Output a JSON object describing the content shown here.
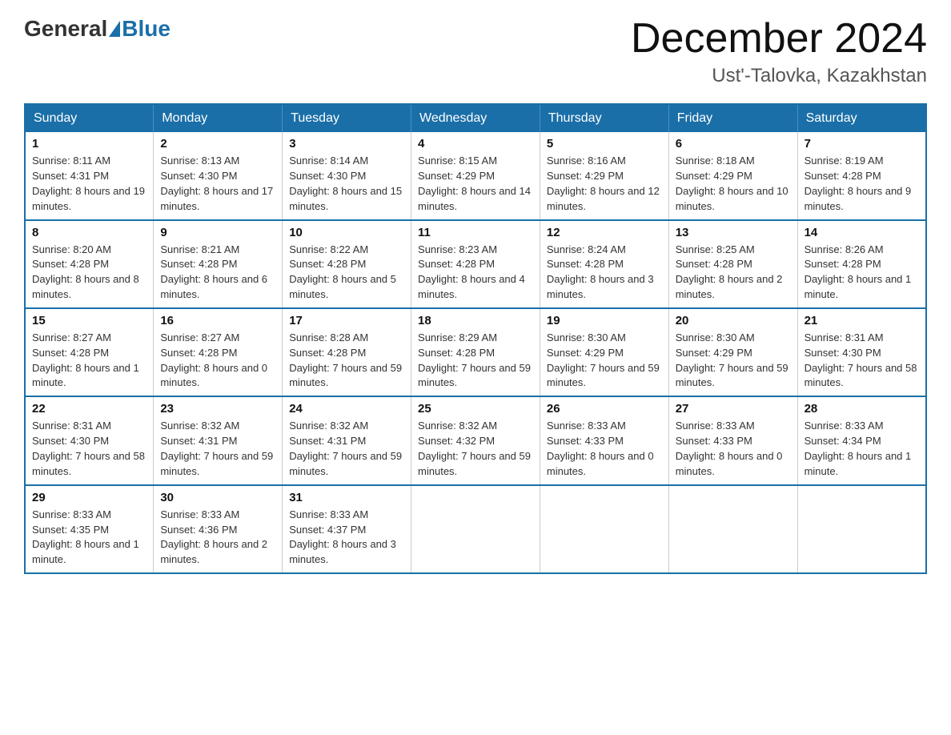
{
  "header": {
    "logo_general": "General",
    "logo_blue": "Blue",
    "title": "December 2024",
    "subtitle": "Ust'-Talovka, Kazakhstan"
  },
  "weekdays": [
    "Sunday",
    "Monday",
    "Tuesday",
    "Wednesday",
    "Thursday",
    "Friday",
    "Saturday"
  ],
  "weeks": [
    [
      {
        "day": "1",
        "sunrise": "8:11 AM",
        "sunset": "4:31 PM",
        "daylight": "8 hours and 19 minutes."
      },
      {
        "day": "2",
        "sunrise": "8:13 AM",
        "sunset": "4:30 PM",
        "daylight": "8 hours and 17 minutes."
      },
      {
        "day": "3",
        "sunrise": "8:14 AM",
        "sunset": "4:30 PM",
        "daylight": "8 hours and 15 minutes."
      },
      {
        "day": "4",
        "sunrise": "8:15 AM",
        "sunset": "4:29 PM",
        "daylight": "8 hours and 14 minutes."
      },
      {
        "day": "5",
        "sunrise": "8:16 AM",
        "sunset": "4:29 PM",
        "daylight": "8 hours and 12 minutes."
      },
      {
        "day": "6",
        "sunrise": "8:18 AM",
        "sunset": "4:29 PM",
        "daylight": "8 hours and 10 minutes."
      },
      {
        "day": "7",
        "sunrise": "8:19 AM",
        "sunset": "4:28 PM",
        "daylight": "8 hours and 9 minutes."
      }
    ],
    [
      {
        "day": "8",
        "sunrise": "8:20 AM",
        "sunset": "4:28 PM",
        "daylight": "8 hours and 8 minutes."
      },
      {
        "day": "9",
        "sunrise": "8:21 AM",
        "sunset": "4:28 PM",
        "daylight": "8 hours and 6 minutes."
      },
      {
        "day": "10",
        "sunrise": "8:22 AM",
        "sunset": "4:28 PM",
        "daylight": "8 hours and 5 minutes."
      },
      {
        "day": "11",
        "sunrise": "8:23 AM",
        "sunset": "4:28 PM",
        "daylight": "8 hours and 4 minutes."
      },
      {
        "day": "12",
        "sunrise": "8:24 AM",
        "sunset": "4:28 PM",
        "daylight": "8 hours and 3 minutes."
      },
      {
        "day": "13",
        "sunrise": "8:25 AM",
        "sunset": "4:28 PM",
        "daylight": "8 hours and 2 minutes."
      },
      {
        "day": "14",
        "sunrise": "8:26 AM",
        "sunset": "4:28 PM",
        "daylight": "8 hours and 1 minute."
      }
    ],
    [
      {
        "day": "15",
        "sunrise": "8:27 AM",
        "sunset": "4:28 PM",
        "daylight": "8 hours and 1 minute."
      },
      {
        "day": "16",
        "sunrise": "8:27 AM",
        "sunset": "4:28 PM",
        "daylight": "8 hours and 0 minutes."
      },
      {
        "day": "17",
        "sunrise": "8:28 AM",
        "sunset": "4:28 PM",
        "daylight": "7 hours and 59 minutes."
      },
      {
        "day": "18",
        "sunrise": "8:29 AM",
        "sunset": "4:28 PM",
        "daylight": "7 hours and 59 minutes."
      },
      {
        "day": "19",
        "sunrise": "8:30 AM",
        "sunset": "4:29 PM",
        "daylight": "7 hours and 59 minutes."
      },
      {
        "day": "20",
        "sunrise": "8:30 AM",
        "sunset": "4:29 PM",
        "daylight": "7 hours and 59 minutes."
      },
      {
        "day": "21",
        "sunrise": "8:31 AM",
        "sunset": "4:30 PM",
        "daylight": "7 hours and 58 minutes."
      }
    ],
    [
      {
        "day": "22",
        "sunrise": "8:31 AM",
        "sunset": "4:30 PM",
        "daylight": "7 hours and 58 minutes."
      },
      {
        "day": "23",
        "sunrise": "8:32 AM",
        "sunset": "4:31 PM",
        "daylight": "7 hours and 59 minutes."
      },
      {
        "day": "24",
        "sunrise": "8:32 AM",
        "sunset": "4:31 PM",
        "daylight": "7 hours and 59 minutes."
      },
      {
        "day": "25",
        "sunrise": "8:32 AM",
        "sunset": "4:32 PM",
        "daylight": "7 hours and 59 minutes."
      },
      {
        "day": "26",
        "sunrise": "8:33 AM",
        "sunset": "4:33 PM",
        "daylight": "8 hours and 0 minutes."
      },
      {
        "day": "27",
        "sunrise": "8:33 AM",
        "sunset": "4:33 PM",
        "daylight": "8 hours and 0 minutes."
      },
      {
        "day": "28",
        "sunrise": "8:33 AM",
        "sunset": "4:34 PM",
        "daylight": "8 hours and 1 minute."
      }
    ],
    [
      {
        "day": "29",
        "sunrise": "8:33 AM",
        "sunset": "4:35 PM",
        "daylight": "8 hours and 1 minute."
      },
      {
        "day": "30",
        "sunrise": "8:33 AM",
        "sunset": "4:36 PM",
        "daylight": "8 hours and 2 minutes."
      },
      {
        "day": "31",
        "sunrise": "8:33 AM",
        "sunset": "4:37 PM",
        "daylight": "8 hours and 3 minutes."
      },
      null,
      null,
      null,
      null
    ]
  ],
  "labels": {
    "sunrise": "Sunrise:",
    "sunset": "Sunset:",
    "daylight": "Daylight:"
  }
}
